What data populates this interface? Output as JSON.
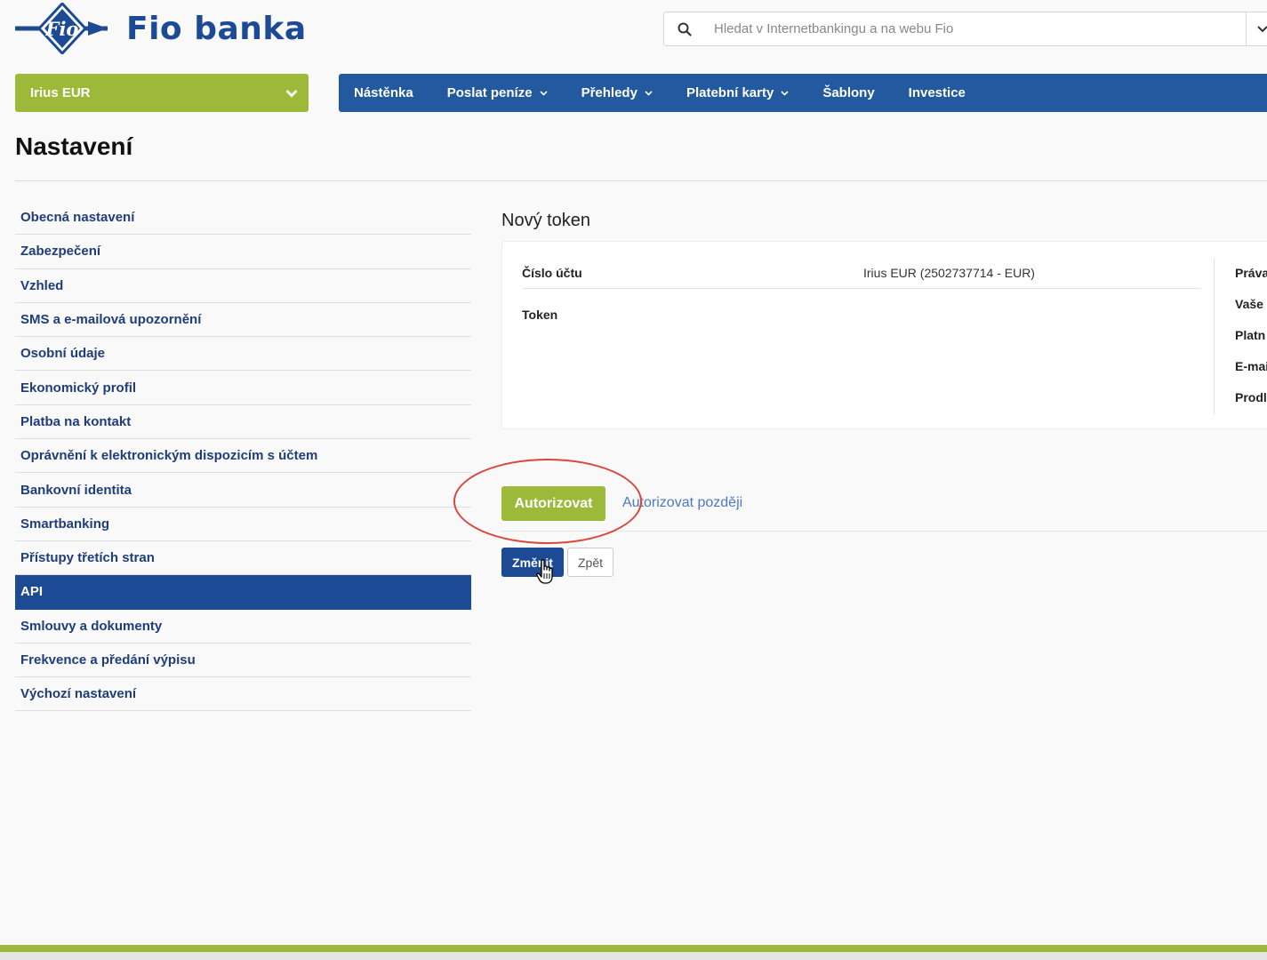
{
  "brand": {
    "name": "Fio banka",
    "mark_text": "Fio"
  },
  "search": {
    "placeholder": "Hledat v Internetbankingu a na webu Fio"
  },
  "account": {
    "selected": "Irius EUR"
  },
  "nav": [
    {
      "label": "Nástěnka",
      "dropdown": false
    },
    {
      "label": "Poslat peníze",
      "dropdown": true
    },
    {
      "label": "Přehledy",
      "dropdown": true
    },
    {
      "label": "Platební karty",
      "dropdown": true
    },
    {
      "label": "Šablony",
      "dropdown": false
    },
    {
      "label": "Investice",
      "dropdown": false
    }
  ],
  "page": {
    "title": "Nastavení"
  },
  "sidebar": {
    "items": [
      {
        "label": "Obecná nastavení"
      },
      {
        "label": "Zabezpečení"
      },
      {
        "label": "Vzhled"
      },
      {
        "label": "SMS a e-mailová upozornění"
      },
      {
        "label": "Osobní údaje"
      },
      {
        "label": "Ekonomický profil"
      },
      {
        "label": "Platba na kontakt"
      },
      {
        "label": "Oprávnění k elektronickým dispozicím s účtem"
      },
      {
        "label": "Bankovní identita"
      },
      {
        "label": "Smartbanking"
      },
      {
        "label": "Přístupy třetích stran"
      },
      {
        "label": "API",
        "active": true
      },
      {
        "label": "Smlouvy a dokumenty"
      },
      {
        "label": "Frekvence a předání výpisu"
      },
      {
        "label": "Výchozí nastavení"
      }
    ]
  },
  "token_form": {
    "title": "Nový token",
    "account_label": "Číslo účtu",
    "account_value": "Irius EUR (2502737714 - EUR)",
    "token_label": "Token",
    "right_labels": [
      "Práva",
      "Vaše",
      "Platn",
      "E-mai",
      "Prodl"
    ]
  },
  "actions": {
    "authorize": "Autorizovat",
    "authorize_later": "Autorizovat později",
    "change": "Změnit",
    "back": "Zpět"
  },
  "colors": {
    "brand_blue": "#1d4a94",
    "nav_blue": "#23599e",
    "accent_green": "#9cb93a",
    "annotation_red": "#d9483b"
  }
}
